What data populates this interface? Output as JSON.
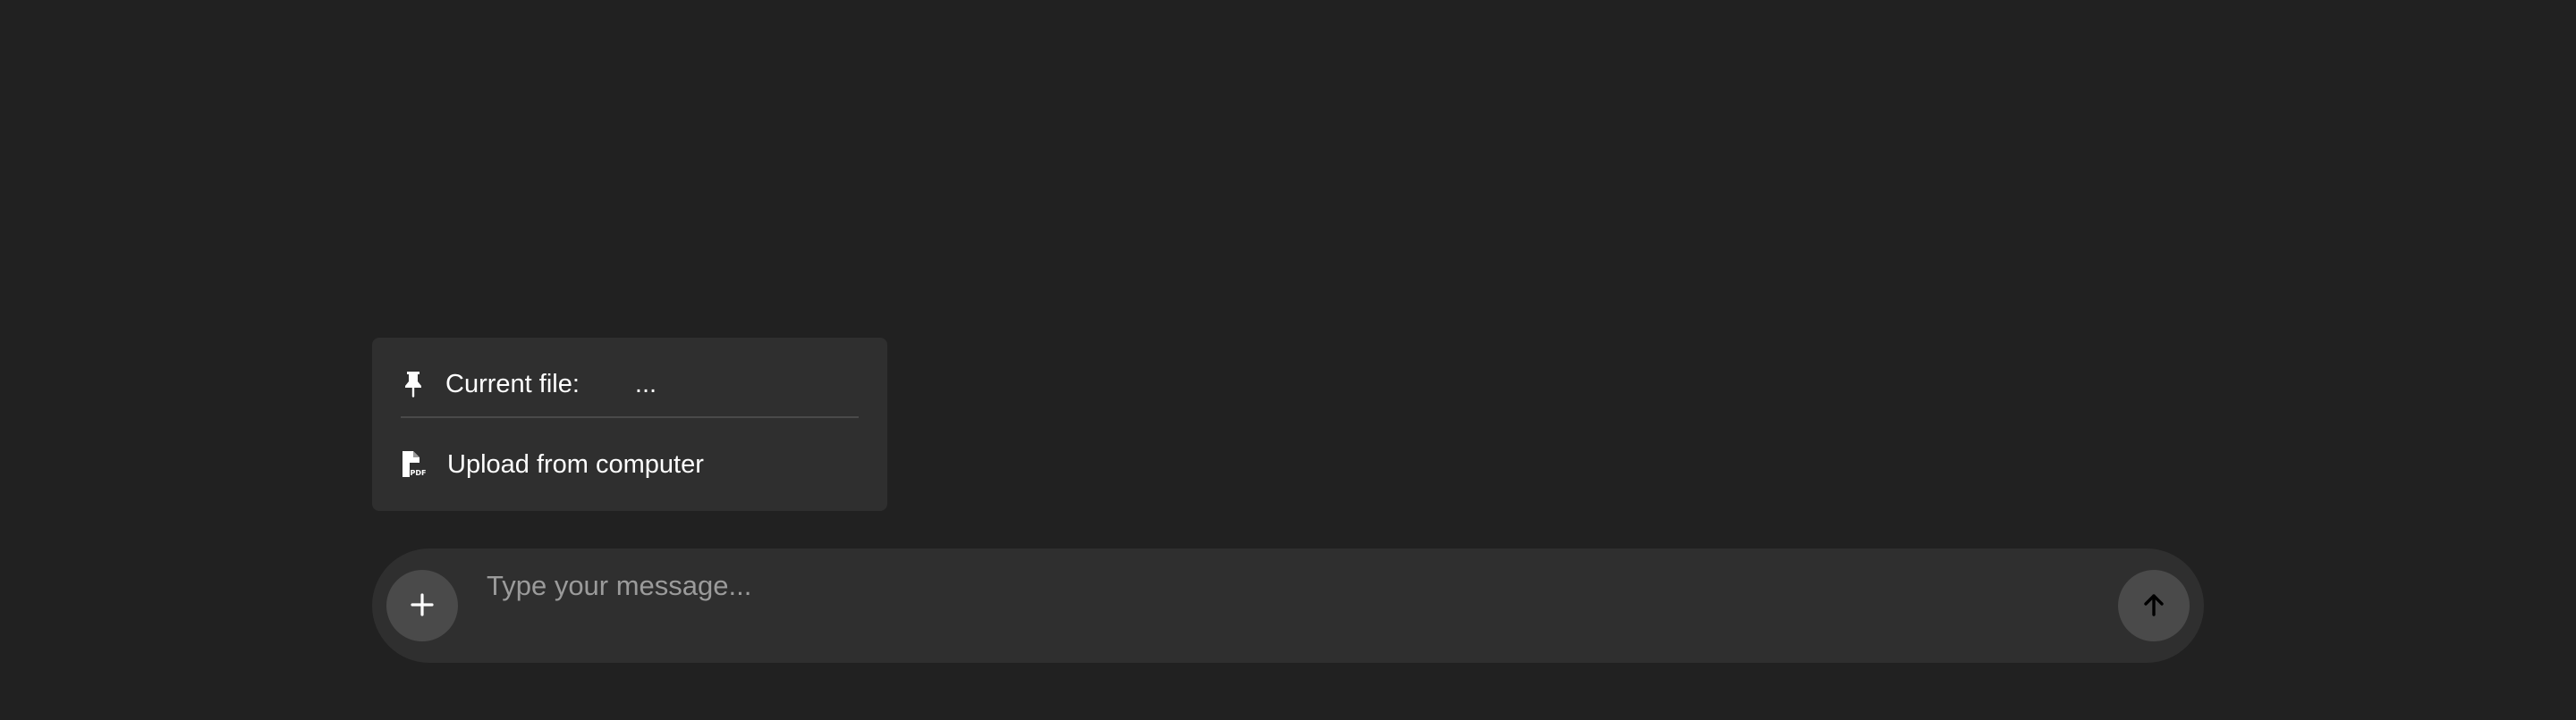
{
  "menu": {
    "current_file": {
      "label": "Current file:",
      "value": "...",
      "icon": "pin-icon"
    },
    "upload": {
      "label": "Upload from computer",
      "icon": "pdf-file-icon"
    }
  },
  "composer": {
    "placeholder": "Type your message...",
    "value": "",
    "add_icon": "plus-icon",
    "send_icon": "arrow-up-icon"
  },
  "colors": {
    "background": "#212121",
    "surface": "#2f2f2f",
    "button": "#4a4a4a",
    "placeholder": "#9b9b9b",
    "text": "#ffffff"
  }
}
